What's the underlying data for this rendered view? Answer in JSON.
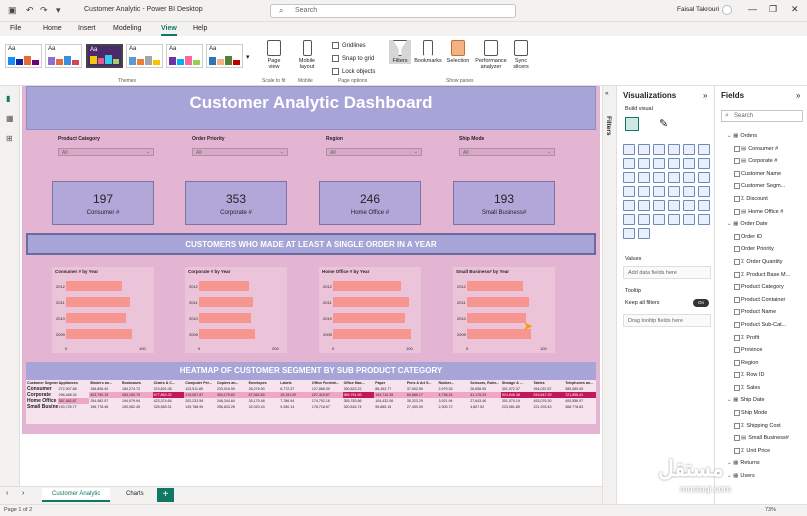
{
  "window": {
    "title": "Customer Analytic - Power BI Desktop",
    "search_placeholder": "Search",
    "user": "Faisal Takrouri",
    "minimize": "—",
    "restore": "❐",
    "close": "✕"
  },
  "menu": [
    "File",
    "Home",
    "Insert",
    "Modeling",
    "View",
    "Help"
  ],
  "ribbon": {
    "themes_label": "Themes",
    "theme_tile_text": "Aa",
    "page_view": "Page view",
    "mobile_layout": "Mobile layout",
    "scale_to_fit": "Scale to fit",
    "mobile": "Mobile",
    "gridlines": "Gridlines",
    "snap_to_grid": "Snap to grid",
    "lock_objects": "Lock objects",
    "page_options": "Page options",
    "filters": "Filters",
    "bookmarks": "Bookmarks",
    "selection": "Selection",
    "performance_analyzer": "Performance analyzer",
    "sync_slicers": "Sync slicers",
    "show_panes": "Show panes"
  },
  "report": {
    "title": "Customer Analytic Dashboard",
    "slicers": [
      {
        "label": "Product Category",
        "value": "All"
      },
      {
        "label": "Order Priority",
        "value": "All"
      },
      {
        "label": "Region",
        "value": "All"
      },
      {
        "label": "Ship Mode",
        "value": "All"
      }
    ],
    "cards": [
      {
        "value": "197",
        "label": "Consumer #"
      },
      {
        "value": "353",
        "label": "Corporate #"
      },
      {
        "value": "246",
        "label": "Home Office #"
      },
      {
        "value": "193",
        "label": "Small Business#"
      }
    ],
    "banner": "CUSTOMERS WHO MADE AT LEAST A SINGLE ORDER IN A YEAR",
    "heatmap_title": "HEATMAP OF CUSTOMER SEGMENT BY SUB PRODUCT CATEGORY"
  },
  "chart_data": [
    {
      "type": "bar",
      "title": "Consumer # by Year",
      "categories": [
        "2012",
        "2011",
        "2010",
        "2009"
      ],
      "values": [
        70,
        80,
        75,
        82
      ],
      "xlim": [
        0,
        100
      ],
      "xticks": [
        "0",
        "100"
      ]
    },
    {
      "type": "bar",
      "title": "Corporate # by Year",
      "categories": [
        "2012",
        "2011",
        "2010",
        "2009"
      ],
      "values": [
        125,
        135,
        130,
        140
      ],
      "xlim": [
        0,
        200
      ],
      "xticks": [
        "0",
        "200"
      ]
    },
    {
      "type": "bar",
      "title": "Home Office # by Year",
      "categories": [
        "2012",
        "2011",
        "2010",
        "2009"
      ],
      "values": [
        85,
        95,
        90,
        98
      ],
      "xlim": [
        0,
        100
      ],
      "xticks": [
        "0",
        "100"
      ]
    },
    {
      "type": "bar",
      "title": "Small Business# by Year",
      "categories": [
        "2012",
        "2011",
        "2010",
        "2009"
      ],
      "values": [
        70,
        78,
        74,
        80
      ],
      "xlim": [
        0,
        100
      ],
      "xticks": [
        "0",
        "100"
      ]
    },
    {
      "type": "table",
      "columns": [
        "Customer Segment",
        "Appliances",
        "Binders an...",
        "Bookcases",
        "Chairs & C...",
        "Computer Per...",
        "Copiers an...",
        "Envelopes",
        "Labels",
        "Office Furnish...",
        "Office Mac...",
        "Paper",
        "Pens & Art S...",
        "Rubber...",
        "Scissors, Ruler...",
        "Storage & ...",
        "Tables",
        "Telephones an..."
      ],
      "rows": [
        {
          "segment": "Consumer",
          "values": [
            "272,307.88",
            "196,806.40",
            "184,274.73",
            "374,601.08",
            "123,511.85",
            "233,016.59",
            "28,276.90",
            "6,772.37",
            "127,868.00",
            "330,823.22",
            "86,453.77",
            "37,002.59",
            "2,979.26",
            "26,658.95",
            "301,972.37",
            "264,037.67",
            "389,089.05"
          ]
        },
        {
          "segment": "Corporate",
          "values": [
            "296,468.34",
            "403,790.19",
            "283,190.79",
            "677,863.32",
            "219,067.87",
            "304,175.62",
            "67,062.83",
            "15,191.00",
            "227,419.67",
            "589,751.59",
            "154,710.35",
            "60,860.17",
            "4,738.24",
            "41,175.23",
            "524,846.38",
            "519,647.29",
            "721,858.41"
          ]
        },
        {
          "segment": "Home Office",
          "values": [
            "387,482.87",
            "254,982.57",
            "194,979.94",
            "423,374.64",
            "202,233.59",
            "246,344.64",
            "35,175.48",
            "7,786.94",
            "174,792.16",
            "355,783.86",
            "104,432.06",
            "35,323.29",
            "3,921.94",
            "27,643.46",
            "301,070.19",
            "453,076.30",
            "400,556.97"
          ]
        },
        {
          "segment": "Small Business",
          "values": [
            "190,725.77",
            "196,778.46",
            "150,062.45",
            "326,583.31",
            "149,788.90",
            "256,833.26",
            "32,020.43",
            "9,280.14",
            "178,718.67",
            "320,816.74",
            "95,865.15",
            "27,450.09",
            "2,305.72",
            "4,807.52",
            "223,081.85",
            "221,293.43",
            "368,778.83"
          ]
        }
      ]
    }
  ],
  "pages": {
    "tabs": [
      "Customer Analytic",
      "Charts"
    ],
    "add": "+",
    "status": "Page 1 of 2",
    "zoom": "73%"
  },
  "panes": {
    "filters": "Filters",
    "visualizations": "Visualizations",
    "build_visual": "Build visual",
    "values": "Values",
    "values_placeholder": "Add data fields here",
    "tooltip": "Tooltip",
    "keep_all_filters": "Keep all filters",
    "toggle": "On",
    "drag_tooltip": "Drag tooltip fields here",
    "fields": "Fields",
    "search_placeholder": "Search",
    "field_items": [
      {
        "label": "Orders",
        "kind": "table"
      },
      {
        "label": "Consumer #",
        "kind": "measure"
      },
      {
        "label": "Corporate #",
        "kind": "measure"
      },
      {
        "label": "Customer Name",
        "kind": "field"
      },
      {
        "label": "Customer Segm...",
        "kind": "field"
      },
      {
        "label": "Discount",
        "kind": "sum"
      },
      {
        "label": "Home Office #",
        "kind": "measure"
      },
      {
        "label": "Order Date",
        "kind": "table"
      },
      {
        "label": "Order ID",
        "kind": "field"
      },
      {
        "label": "Order Priority",
        "kind": "field"
      },
      {
        "label": "Order Quantity",
        "kind": "sum"
      },
      {
        "label": "Product Base M...",
        "kind": "sum"
      },
      {
        "label": "Product Category",
        "kind": "field"
      },
      {
        "label": "Product Container",
        "kind": "field"
      },
      {
        "label": "Product Name",
        "kind": "field"
      },
      {
        "label": "Product Sub-Cat...",
        "kind": "field"
      },
      {
        "label": "Profit",
        "kind": "sum"
      },
      {
        "label": "Province",
        "kind": "field"
      },
      {
        "label": "Region",
        "kind": "field"
      },
      {
        "label": "Row ID",
        "kind": "sum"
      },
      {
        "label": "Sales",
        "kind": "sum"
      },
      {
        "label": "Ship Date",
        "kind": "table"
      },
      {
        "label": "Ship Mode",
        "kind": "field"
      },
      {
        "label": "Shipping Cost",
        "kind": "sum"
      },
      {
        "label": "Small Business#",
        "kind": "measure"
      },
      {
        "label": "Unit Price",
        "kind": "sum"
      },
      {
        "label": "Returns",
        "kind": "table"
      },
      {
        "label": "Users",
        "kind": "table"
      }
    ]
  },
  "watermark": {
    "arabic": "مستقل",
    "latin": "mostaql.com"
  },
  "colors": {
    "accent": "#117865",
    "report_bg": "#e3b5d2",
    "header": "#a7a4d8",
    "bar": "#f7958f"
  }
}
